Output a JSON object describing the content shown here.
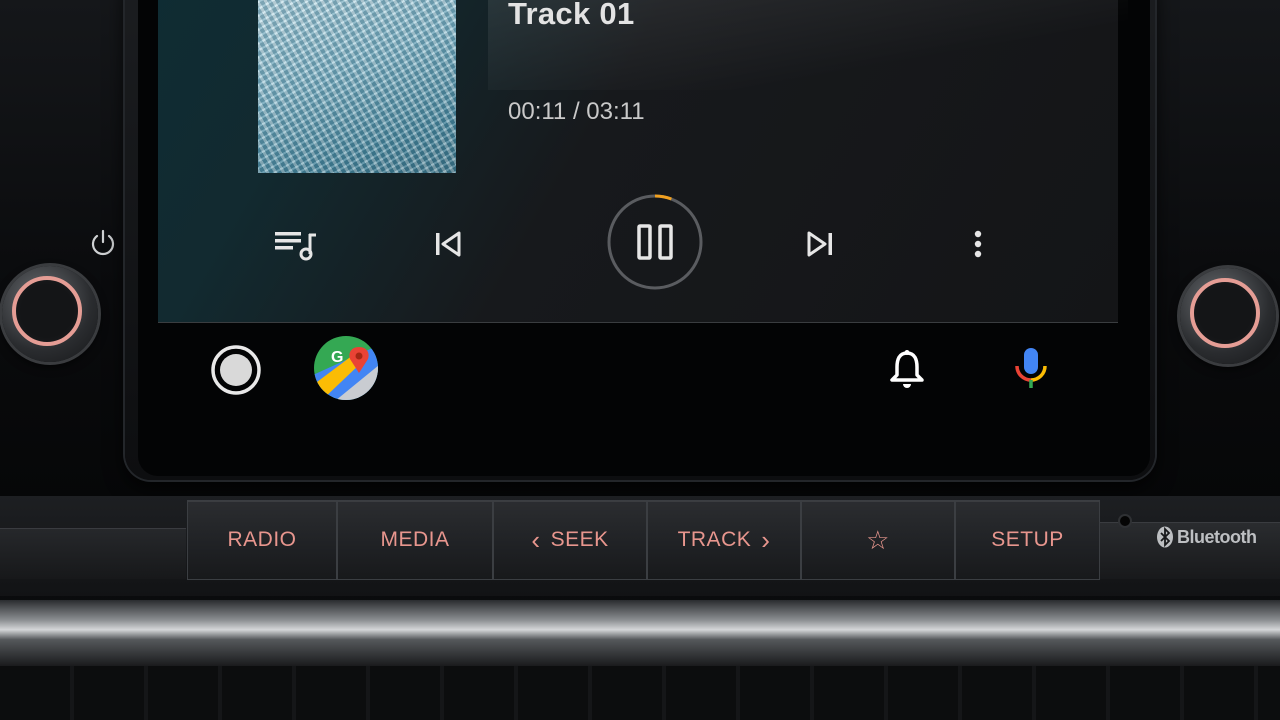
{
  "media": {
    "track_title": "Track 01",
    "time_display": "00:11 / 03:11",
    "progress_fraction": 0.058,
    "controls": [
      "queue-icon",
      "previous-track-icon",
      "pause-icon",
      "next-track-icon",
      "more-options-icon"
    ]
  },
  "nav_bar": {
    "icons": [
      "home-icon",
      "google-maps-icon",
      "notification-bell-icon",
      "microphone-icon"
    ]
  },
  "hardware_buttons": [
    {
      "label": "RADIO"
    },
    {
      "label": "MEDIA"
    },
    {
      "label": "SEEK",
      "prefix": "‹"
    },
    {
      "label": "TRACK",
      "suffix": "›"
    },
    {
      "label": "☆"
    },
    {
      "label": "SETUP"
    }
  ],
  "brand": {
    "bluetooth_label": "Bluetooth"
  },
  "colors": {
    "accent": "#e8968e",
    "progress": "#f0a020",
    "screen_bg": "#030405"
  }
}
